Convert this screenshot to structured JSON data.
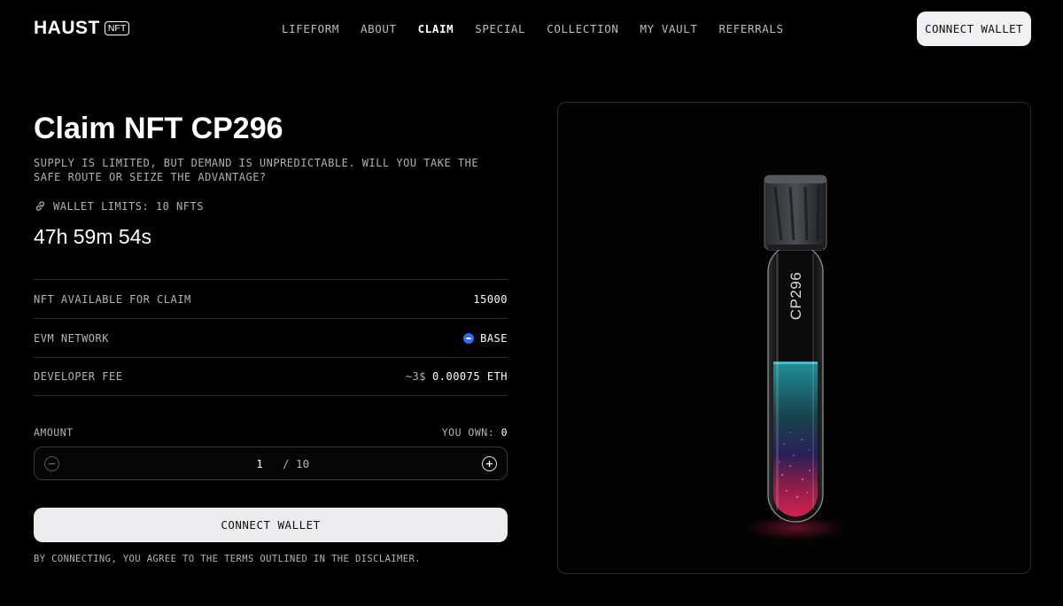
{
  "header": {
    "logo_text": "HAUST",
    "logo_badge": "NFT",
    "nav": [
      "LIFEFORM",
      "ABOUT",
      "CLAIM",
      "SPECIAL",
      "COLLECTION",
      "MY VAULT",
      "REFERRALS"
    ],
    "active_nav": "CLAIM",
    "connect_label": "CONNECT WALLET"
  },
  "claim": {
    "title": "Claim NFT CP296",
    "description": "SUPPLY IS LIMITED, BUT DEMAND IS UNPREDICTABLE. WILL YOU TAKE THE SAFE ROUTE OR SEIZE THE ADVANTAGE?",
    "wallet_limits": "WALLET LIMITS: 10 NFTS",
    "timer": "47h 59m 54s"
  },
  "info": [
    {
      "label": "NFT AVAILABLE FOR CLAIM",
      "value": "15000"
    },
    {
      "label": "EVM NETWORK",
      "value": "BASE",
      "icon": "base-network-icon"
    },
    {
      "label": "DEVELOPER FEE",
      "prefix": "~3$",
      "value": "0.00075 ETH"
    }
  ],
  "amount": {
    "label": "AMOUNT",
    "you_own_label": "YOU OWN:",
    "you_own_value": "0",
    "quantity": "1",
    "max": "/ 10"
  },
  "cta": {
    "label": "CONNECT WALLET",
    "disclaimer": "BY CONNECTING, YOU AGREE TO THE TERMS OUTLINED IN THE DISCLAIMER."
  },
  "product": {
    "tube_label": "CP296",
    "liquid_colors": {
      "top": "#1f8e98",
      "bottom": "#d0224f"
    }
  },
  "colors": {
    "background": "#000000",
    "button_bg": "#f1f1f3",
    "base_blue": "#2e6cf6"
  }
}
